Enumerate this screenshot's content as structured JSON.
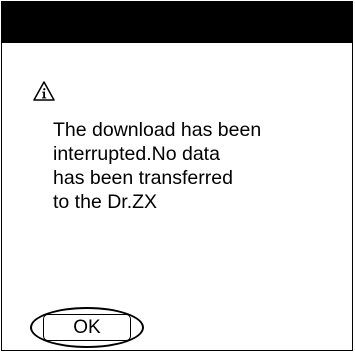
{
  "dialog": {
    "icon": "info-warning-icon",
    "message_lines": [
      "The download has been",
      "interrupted.No data",
      "has been transferred",
      "to the Dr.ZX"
    ],
    "ok_label": "OK"
  }
}
